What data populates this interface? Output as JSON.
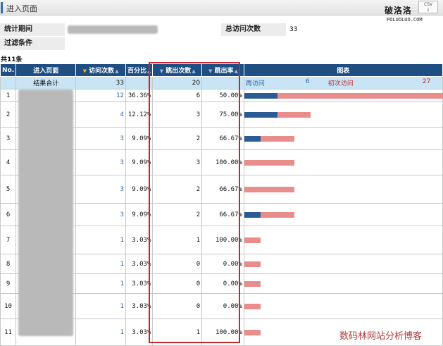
{
  "header": {
    "title": "进入页面",
    "csv_label": "CSV",
    "csv_arrow": "⇩"
  },
  "watermark": {
    "top": "破洛洛",
    "top_sub": "POLUOLUO.COM",
    "bottom": "数码林网站分析博客"
  },
  "filters": {
    "period_label": "统计期间",
    "total_visits_label": "总访问次数",
    "total_visits_value": "33",
    "filter_label": "过滤条件"
  },
  "total_count": "共11条",
  "table": {
    "headers": {
      "no": "No.",
      "page": "进入页面",
      "visits": "访问次数",
      "percent": "百分比",
      "bounces": "跳出次数",
      "bounce_rate": "跳出率",
      "chart": "图表"
    },
    "summary": {
      "label": "结果合计",
      "visits": "33",
      "bounces": "20",
      "legend_return": "再访问",
      "legend_return_value": "6",
      "legend_first": "初次访问",
      "legend_first_value": "27"
    },
    "rows": [
      {
        "no": "1",
        "visits": "12",
        "percent": "36.36%",
        "bounces": "6",
        "bounce_rate": "50.00%",
        "return_frac": 0.166,
        "total_frac": 1.0
      },
      {
        "no": "2",
        "visits": "4",
        "percent": "12.12%",
        "bounces": "3",
        "bounce_rate": "75.00%",
        "return_frac": 0.166,
        "total_frac": 0.333
      },
      {
        "no": "3",
        "visits": "3",
        "percent": "9.09%",
        "bounces": "2",
        "bounce_rate": "66.67%",
        "return_frac": 0.083,
        "total_frac": 0.25
      },
      {
        "no": "4",
        "visits": "3",
        "percent": "9.09%",
        "bounces": "3",
        "bounce_rate": "100.00%",
        "return_frac": 0,
        "total_frac": 0.25
      },
      {
        "no": "5",
        "visits": "3",
        "percent": "9.09%",
        "bounces": "2",
        "bounce_rate": "66.67%",
        "return_frac": 0,
        "total_frac": 0.25
      },
      {
        "no": "6",
        "visits": "3",
        "percent": "9.09%",
        "bounces": "2",
        "bounce_rate": "66.67%",
        "return_frac": 0.083,
        "total_frac": 0.25
      },
      {
        "no": "7",
        "visits": "1",
        "percent": "3.03%",
        "bounces": "1",
        "bounce_rate": "100.00%",
        "return_frac": 0,
        "total_frac": 0.083
      },
      {
        "no": "8",
        "visits": "1",
        "percent": "3.03%",
        "bounces": "0",
        "bounce_rate": "0.00%",
        "return_frac": 0,
        "total_frac": 0.083
      },
      {
        "no": "9",
        "visits": "1",
        "percent": "3.03%",
        "bounces": "0",
        "bounce_rate": "0.00%",
        "return_frac": 0,
        "total_frac": 0.083
      },
      {
        "no": "10",
        "visits": "1",
        "percent": "3.03%",
        "bounces": "0",
        "bounce_rate": "0.00%",
        "return_frac": 0,
        "total_frac": 0.083
      },
      {
        "no": "11",
        "visits": "1",
        "percent": "3.03%",
        "bounces": "1",
        "bounce_rate": "100.00%",
        "return_frac": 0,
        "total_frac": 0.083
      }
    ]
  },
  "colors": {
    "header_bg": "#1f4e82",
    "return_bar": "#2a5b94",
    "first_bar": "#e88c8c",
    "highlight_box": "#c8262d",
    "summary_bg": "#c8e4f5"
  }
}
